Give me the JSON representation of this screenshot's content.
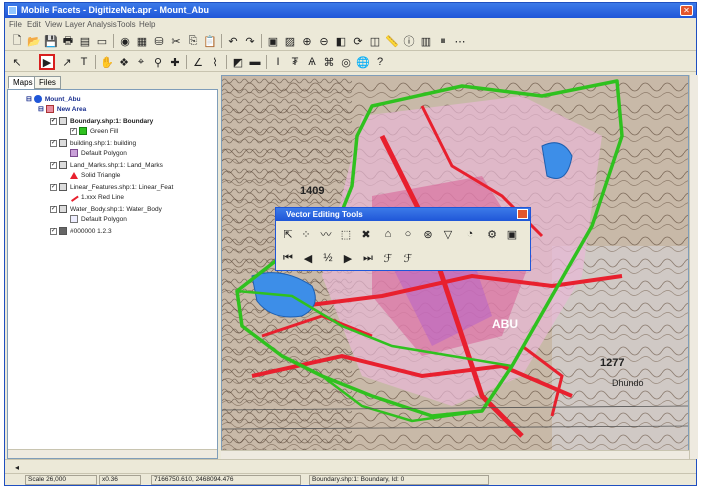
{
  "window": {
    "title": "Mobile Facets - DigitizeNet.apr - Mount_Abu"
  },
  "menu": [
    "File",
    "Edit",
    "View",
    "Layer",
    "Analysis",
    "Tools",
    "Help"
  ],
  "tabs": [
    "Maps",
    "Files"
  ],
  "toc": {
    "map_name": "Mount_Abu",
    "group_name": "New Area",
    "layers": [
      {
        "name": "Boundary.shp:1: Boundary",
        "symbol_label": "Green Fill"
      },
      {
        "name": "building.shp:1: building",
        "symbol_label": "Default Polygon"
      },
      {
        "name": "Land_Marks.shp:1: Land_Marks",
        "symbol_label": "Solid Triangle"
      },
      {
        "name": "Linear_Features.shp:1: Linear_Feat",
        "symbol_label": "1.xxx Red Line"
      },
      {
        "name": "Water_Body.shp:1: Water_Body",
        "symbol_label": "Default Polygon"
      },
      {
        "name": "#000000 1.2.3",
        "symbol_label": ""
      }
    ]
  },
  "vector_toolbar": {
    "title": "Vector Editing Tools"
  },
  "map_labels": [
    "1409",
    "1277",
    "ABU",
    "Dhundo"
  ],
  "status": {
    "scale": "Scale 26,000",
    "zoom": "x0.36",
    "coords": "7166750.610, 2468094.476",
    "layer": "Boundary.shp:1: Boundary, Id: 0"
  },
  "colors": {
    "title_bar": "#1f56d8",
    "boundary": "#2fc11f",
    "roads": "#e8202e",
    "water": "#3d8ee8",
    "highlight": "#d81f1f"
  }
}
